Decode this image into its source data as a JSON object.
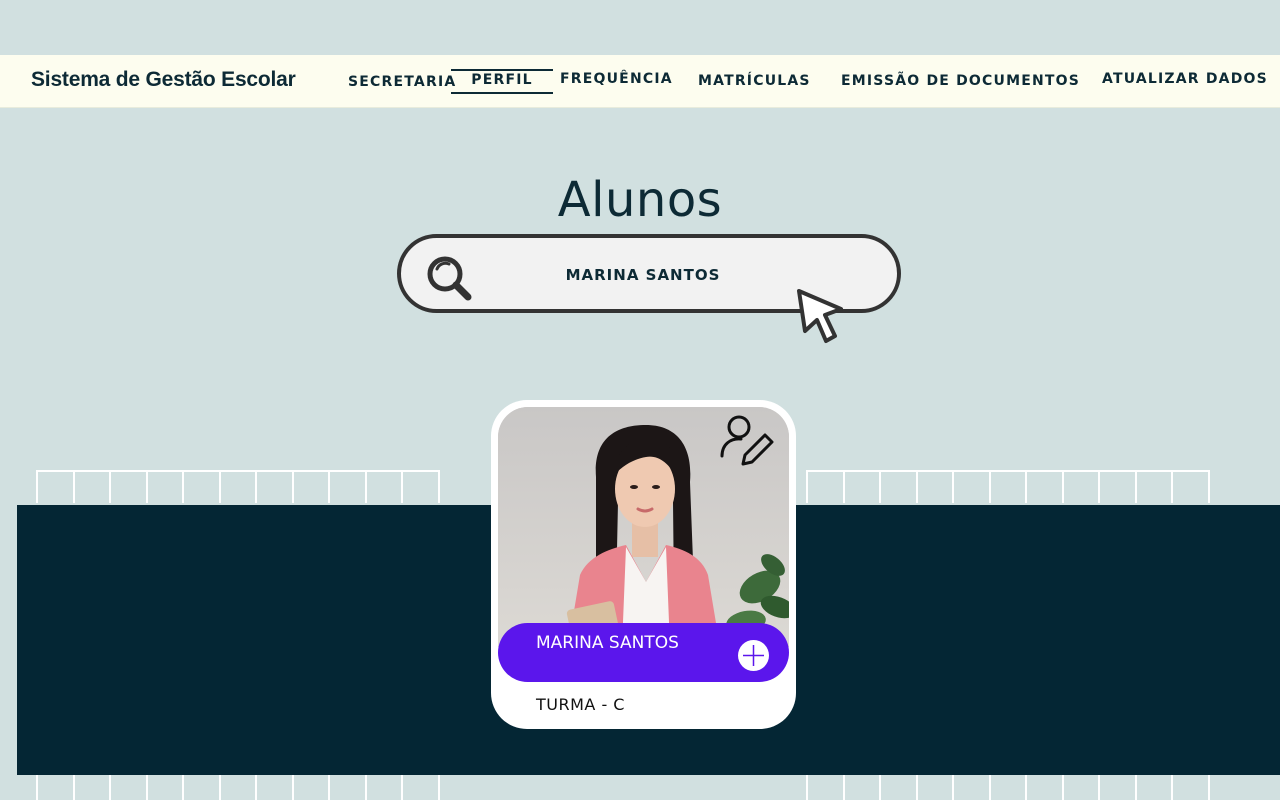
{
  "header": {
    "brand": "Sistema de Gestão Escolar",
    "nav": [
      {
        "label": "SECRETARIA"
      },
      {
        "label": "PERFIL",
        "active": true
      },
      {
        "label": "FREQUÊNCIA"
      },
      {
        "label": "MATRÍCULAS"
      },
      {
        "label": "EMISSÃO DE DOCUMENTOS"
      },
      {
        "label": "ATUALIZAR DADOS"
      }
    ]
  },
  "main": {
    "title": "Alunos",
    "search": {
      "value": "MARINA SANTOS",
      "icon": "search-icon"
    }
  },
  "student_card": {
    "name": "MARINA SANTOS",
    "class": "TURMA - C",
    "edit_icon": "user-edit-icon",
    "add_icon": "plus-icon"
  },
  "colors": {
    "background": "#d1e0e0",
    "navbar": "#fdfdef",
    "text_dark": "#0d2a35",
    "band": "#042634",
    "accent": "#5b16ec"
  }
}
